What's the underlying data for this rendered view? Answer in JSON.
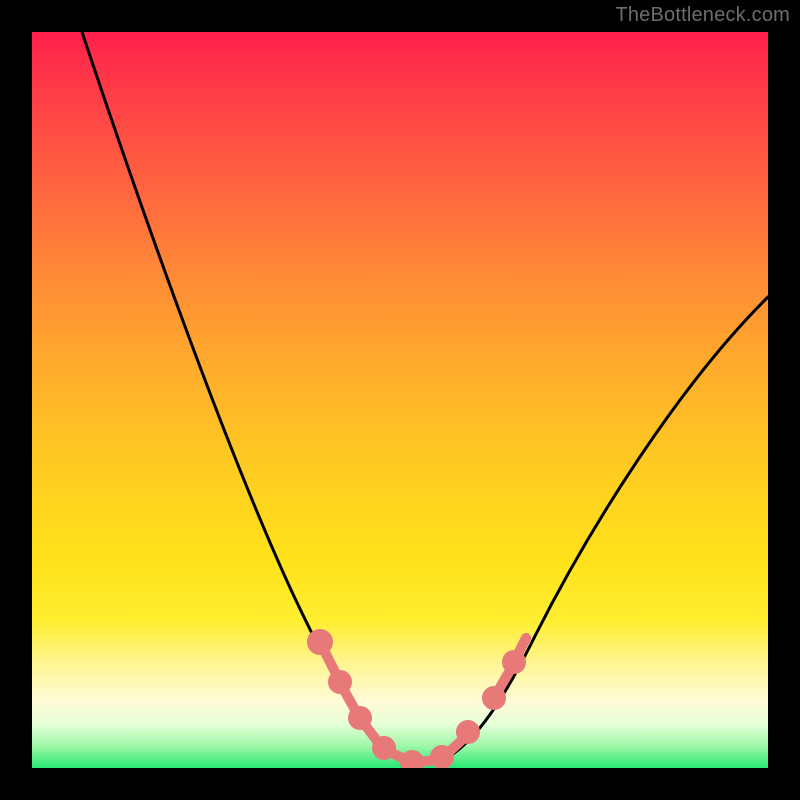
{
  "watermark": {
    "text": "TheBottleneck.com"
  },
  "chart_data": {
    "type": "line",
    "title": "",
    "xlabel": "",
    "ylabel": "",
    "x": [
      0.0,
      0.05,
      0.1,
      0.15,
      0.2,
      0.25,
      0.3,
      0.35,
      0.4,
      0.42,
      0.45,
      0.48,
      0.5,
      0.53,
      0.56,
      0.6,
      0.62,
      0.7,
      0.8,
      0.9,
      1.0
    ],
    "y": [
      1.0,
      0.9,
      0.8,
      0.7,
      0.6,
      0.49,
      0.38,
      0.26,
      0.13,
      0.08,
      0.03,
      0.01,
      0.0,
      0.01,
      0.03,
      0.09,
      0.12,
      0.24,
      0.39,
      0.52,
      0.64
    ],
    "xlim": [
      0,
      1
    ],
    "ylim": [
      0,
      1
    ],
    "highlight_segments": [
      {
        "x0": 0.39,
        "x1": 0.44
      },
      {
        "x0": 0.45,
        "x1": 0.58
      },
      {
        "x0": 0.6,
        "x1": 0.64
      }
    ],
    "gradient_stops": [
      {
        "pos": 0.0,
        "color": "#ff1f4b"
      },
      {
        "pos": 0.5,
        "color": "#ffbe26"
      },
      {
        "pos": 0.9,
        "color": "#fffbd8"
      },
      {
        "pos": 1.0,
        "color": "#27e874"
      }
    ]
  }
}
